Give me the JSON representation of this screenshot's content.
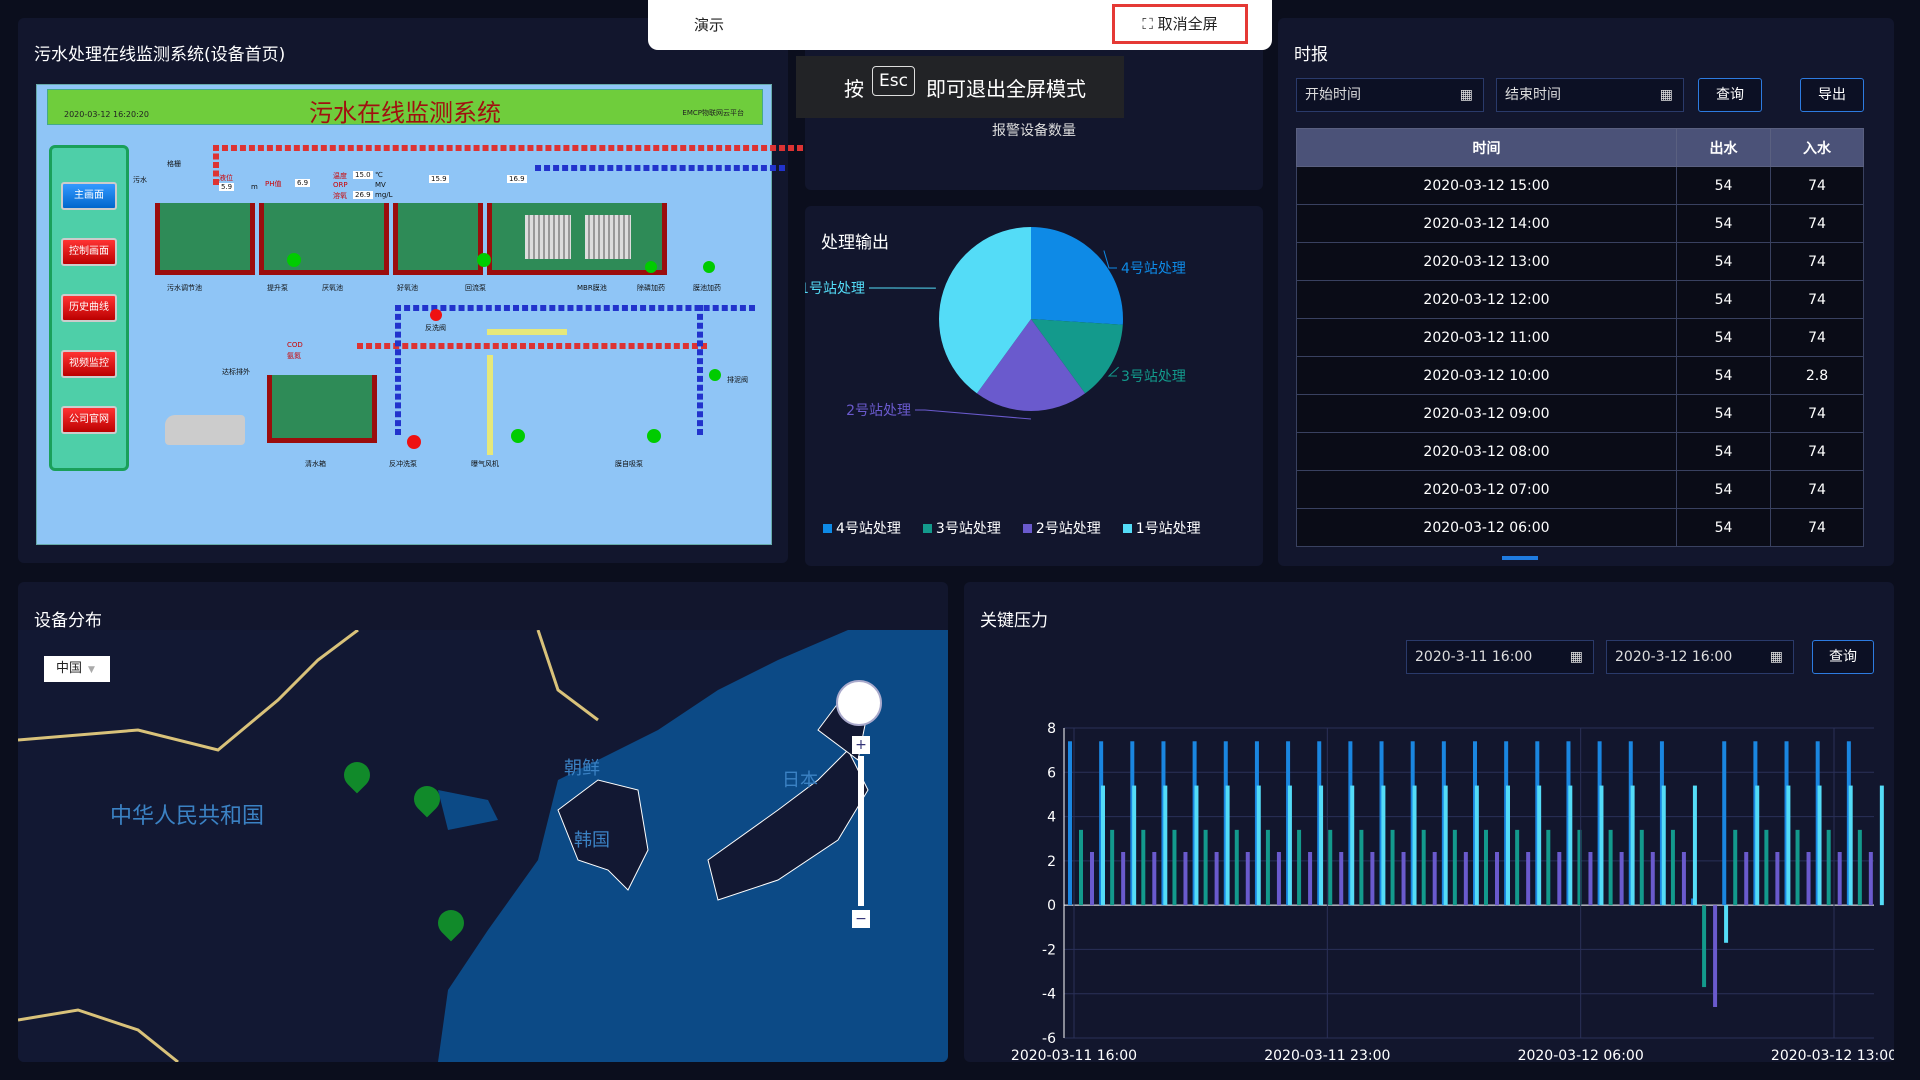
{
  "scada": {
    "panel_title": "污水处理在线监测系统(设备首页)",
    "title": "污水在线监测系统",
    "time": "2020-03-12 16:20:20",
    "platform": "EMCP物联网云平台",
    "nav": [
      "主画面",
      "控制画面",
      "历史曲线",
      "视频监控",
      "公司官网"
    ],
    "labels": [
      "污水调节池",
      "提升泵",
      "厌氧池",
      "好氧池",
      "回流泵",
      "MBR膜池",
      "除磷加药",
      "膜池加药",
      "反洗阀",
      "排泥阀",
      "清水箱",
      "反冲洗泵",
      "曝气风机",
      "膜自吸泵",
      "达标排外",
      "格栅",
      "污水"
    ],
    "readings": [
      "液位",
      "PH值",
      "温度",
      "ORP",
      "溶氧",
      "COD",
      "氨氮",
      "m",
      "℃",
      "MV",
      "mg/L",
      "5.9",
      "6.9",
      "15.0",
      "15.9",
      "16.9",
      "26.9"
    ]
  },
  "alarm": {
    "label": "报警设备数量"
  },
  "pie": {
    "title": "处理输出",
    "labels": [
      "4号站处理",
      "3号站处理",
      "2号站处理",
      "1号站处理"
    ]
  },
  "chart_data": [
    {
      "type": "pie",
      "categories": [
        "4号站处理",
        "3号站处理",
        "2号站处理",
        "1号站处理"
      ],
      "values": [
        26,
        14,
        20,
        40
      ],
      "colors": [
        "#0e8ae6",
        "#139a8c",
        "#6a5acd",
        "#54dcf7"
      ],
      "legend": "bottom"
    },
    {
      "type": "bar",
      "x_labels": [
        "2020-03-11 16:00",
        "2020-03-11 23:00",
        "2020-03-12 06:00",
        "2020-03-12 13:00"
      ],
      "ylim": [
        -6,
        8
      ],
      "yticks": [
        8,
        6,
        4,
        2,
        0,
        -2,
        -4,
        -6
      ],
      "series": [
        {
          "values": [
            7.4,
            7.4,
            7.4,
            7.4,
            7.4,
            7.4,
            7.4,
            7.4,
            7.4,
            7.4,
            7.4,
            7.4,
            7.4,
            7.4,
            7.4,
            7.4,
            7.4,
            7.4,
            7.4,
            7.4,
            0.3,
            7.4,
            7.4,
            7.4,
            7.4,
            7.4
          ],
          "color": "#1a86e0"
        },
        {
          "values": [
            3.4,
            3.4,
            3.4,
            3.4,
            3.4,
            3.4,
            3.4,
            3.4,
            3.4,
            3.4,
            3.4,
            3.4,
            3.4,
            3.4,
            3.4,
            3.4,
            3.4,
            3.4,
            3.4,
            3.4,
            -3.7,
            3.4,
            3.4,
            3.4,
            3.4,
            3.4
          ],
          "color": "#139a8c"
        },
        {
          "values": [
            2.4,
            2.4,
            2.4,
            2.4,
            2.4,
            2.4,
            2.4,
            2.4,
            2.4,
            2.4,
            2.4,
            2.4,
            2.4,
            2.4,
            2.4,
            2.4,
            2.4,
            2.4,
            2.4,
            2.4,
            -4.6,
            2.4,
            2.4,
            2.4,
            2.4,
            2.4
          ],
          "color": "#6a5acd"
        },
        {
          "values": [
            5.4,
            5.4,
            5.4,
            5.4,
            5.4,
            5.4,
            5.4,
            5.4,
            5.4,
            5.4,
            5.4,
            5.4,
            5.4,
            5.4,
            5.4,
            5.4,
            5.4,
            5.4,
            5.4,
            5.4,
            -1.7,
            5.4,
            5.4,
            5.4,
            5.4,
            5.4
          ],
          "color": "#54dcf7"
        }
      ]
    }
  ],
  "report": {
    "title": "时报",
    "start_placeholder": "开始时间",
    "end_placeholder": "结束时间",
    "query": "查询",
    "export": "导出",
    "headers": [
      "时间",
      "出水",
      "入水"
    ],
    "rows": [
      [
        "2020-03-12 15:00",
        "54",
        "74"
      ],
      [
        "2020-03-12 14:00",
        "54",
        "74"
      ],
      [
        "2020-03-12 13:00",
        "54",
        "74"
      ],
      [
        "2020-03-12 12:00",
        "54",
        "74"
      ],
      [
        "2020-03-12 11:00",
        "54",
        "74"
      ],
      [
        "2020-03-12 10:00",
        "54",
        "2.8"
      ],
      [
        "2020-03-12 09:00",
        "54",
        "74"
      ],
      [
        "2020-03-12 08:00",
        "54",
        "74"
      ],
      [
        "2020-03-12 07:00",
        "54",
        "74"
      ],
      [
        "2020-03-12 06:00",
        "54",
        "74"
      ]
    ]
  },
  "map": {
    "title": "设备分布",
    "region": "中国",
    "labels": [
      "中华人民共和国",
      "朝鲜",
      "韩国",
      "日本"
    ]
  },
  "pressure": {
    "title": "关键压力",
    "start": "2020-3-11 16:00",
    "end": "2020-3-12 16:00",
    "query": "查询"
  },
  "fullscreen": {
    "demo": "演示",
    "exit": "取消全屏",
    "press": "按",
    "esc": "Esc",
    "hint": "即可退出全屏模式"
  }
}
